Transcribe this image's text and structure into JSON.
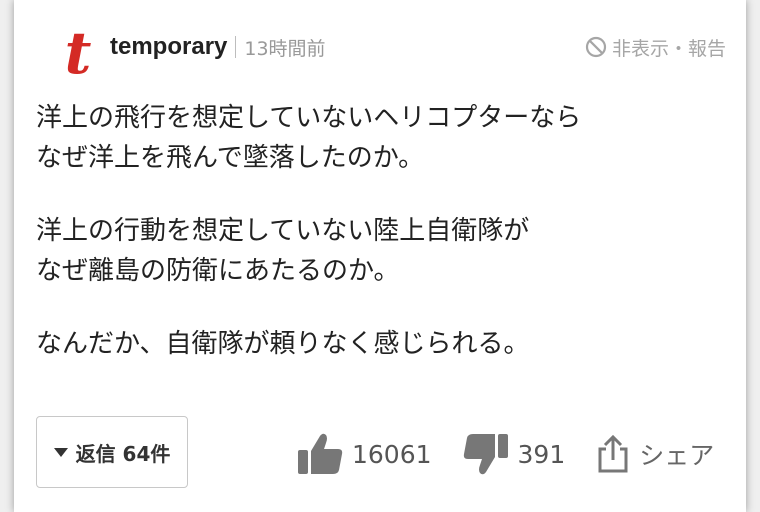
{
  "comment": {
    "avatar_letter": "t",
    "username": "temporary",
    "posted": "13時間前",
    "report_label": "非表示・報告",
    "paragraphs": [
      "洋上の飛行を想定していないヘリコプターなら\nなぜ洋上を飛んで墜落したのか。",
      "洋上の行動を想定していない陸上自衛隊が\nなぜ離島の防衛にあたるのか。",
      "なんだか、自衛隊が頼りなく感じられる。"
    ],
    "reply_label": "返信 64件",
    "likes": "16061",
    "dislikes": "391",
    "share_label": "シェア"
  },
  "colors": {
    "avatar": "#d42a25",
    "muted": "#a6a6a6",
    "icon": "#777777"
  }
}
